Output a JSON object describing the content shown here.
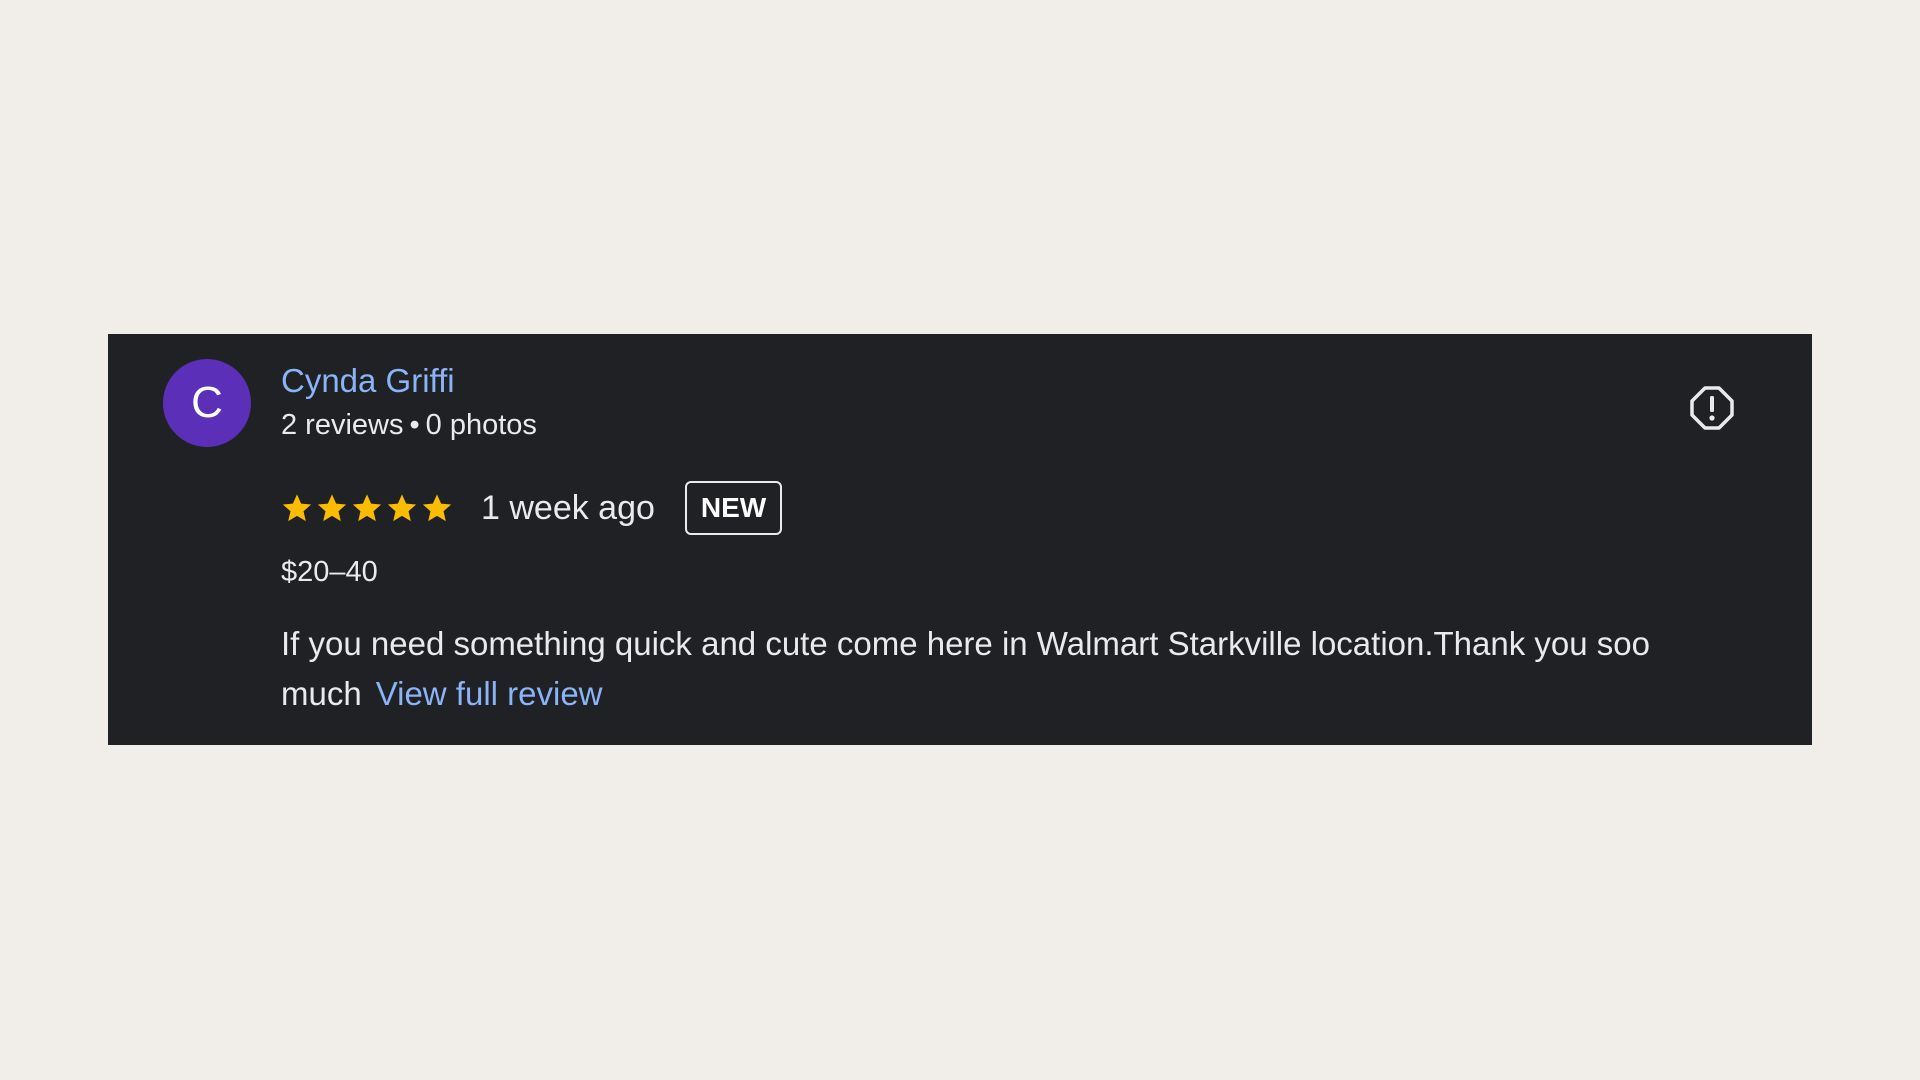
{
  "review": {
    "avatar_letter": "C",
    "avatar_color": "#5b2fb8",
    "reviewer_name": "Cynda Griffi",
    "reviews_count": "2 reviews",
    "separator": "•",
    "photos_count": "0 photos",
    "rating": 5,
    "rating_max": 5,
    "star_color": "#fbbc04",
    "time_ago": "1 week ago",
    "badge": "NEW",
    "price_range": "$20–40",
    "text": "If you need something quick and cute come here in Walmart Starkville location.Thank you soo much",
    "view_full_label": "View full review",
    "report_icon": "report-flag-icon"
  },
  "colors": {
    "page_background": "#f1eee9",
    "card_background": "#202124",
    "link": "#8ab4f8",
    "text": "#e8eaed"
  }
}
